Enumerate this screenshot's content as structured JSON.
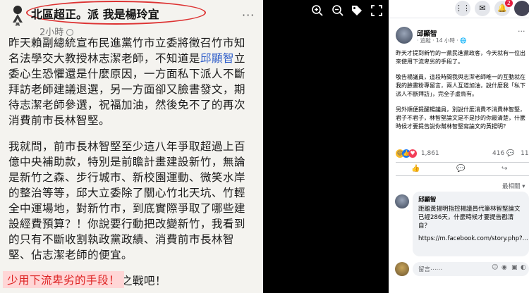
{
  "left_post": {
    "author": "北區超正。派 我是楊玲宜",
    "time": "2小時",
    "more": "···",
    "paragraph1_a": "昨天賴副總統宣布民進黨竹市立委將徵召竹市知名法學交大教授林志潔老師，不知道是",
    "paragraph1_mention": "邱顯智",
    "paragraph1_b": "立委心生恐懼還是什麼原因，一方面私下派人不斷拜訪老師建議退選，另一方面卻又臉書發文，期待志潔老師參選，祝福加油，然後免不了的再次消費前市長林智堅。",
    "paragraph2": "我就問，前市長林智堅至少這八年爭取超過上百億中央補助款，特別是前瞻計畫建設新竹，無論是新竹之森、步行城市、新校園運動、微笑水岸的整治等等，邱大立委除了關心竹北天坑、竹輕全中運場地，對新竹市，到底實際爭取了哪些建設經費預算？！你說要行動把改變新竹，我看到的只有不斷收割執政黨政績、消費前市長林智堅、佔志潔老師的便宜。",
    "paragraph3": "真的蠻失望，來場君子之戰吧！",
    "highlight": "少用下流卑劣的手段！"
  },
  "viewer": {
    "icons": [
      "zoom-in-icon",
      "zoom-out-icon",
      "tag-icon",
      "fullscreen-icon"
    ]
  },
  "right_post": {
    "topbar_badge": "2",
    "author": "邱顯智",
    "meta": "· 追蹤 · 14 小時 · 🌐",
    "more": "···",
    "p1": "昨天才提到新竹的一黨民進黨政客，今天就有一位出來使用下流卑劣的手段了。",
    "p2": "敬告楊議員，這段時間我與志潔老師唯一的互動就在我的臉書粉專留言，兩人互道加油，說什麼我「私下派人不斷拜訪」，完全子虛烏有。",
    "p3": "另外順便提醒楊議員，別說什麼消費不消費林智堅，君子不君子，林智堅論文是不是抄的你最清楚，什麼時候才要提告說你幫林智堅寫論文的黃揚明？",
    "reaction_count": "1,861",
    "comment_count": "416 💬",
    "share_count": "11 ↪",
    "sort_label": "最相關 ▾",
    "comment": {
      "author": "邱顯智",
      "text": "距離黃揚明指控楊議員代筆林智堅論文已經286天，什麼時候才要提告戳清自？",
      "link": "https://m.facebook.com/story.php?..."
    },
    "input_placeholder": "留言⋯⋯"
  }
}
